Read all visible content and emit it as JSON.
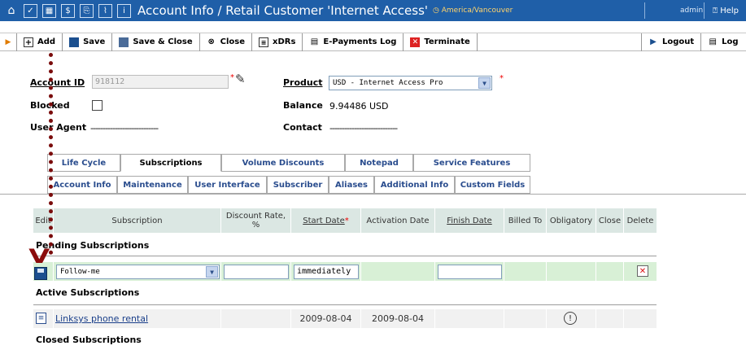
{
  "header": {
    "title": "Account Info / Retail Customer 'Internet Access'",
    "timezone": "America/Vancouver",
    "user": "admin",
    "help": "Help",
    "icons": [
      "home-icon",
      "check-icon",
      "grid-icon",
      "dollar-icon",
      "doc-icon",
      "chart-icon",
      "info-icon"
    ]
  },
  "toolbar": {
    "add": "Add",
    "save": "Save",
    "save_close": "Save & Close",
    "close": "Close",
    "xdrs": "xDRs",
    "epayments": "E-Payments Log",
    "terminate": "Terminate",
    "logout": "Logout",
    "log": "Log"
  },
  "form": {
    "account_id_label": "Account ID",
    "account_id_value": "918112",
    "product_label": "Product",
    "product_value": "USD - Internet Access Pro",
    "blocked_label": "Blocked",
    "balance_label": "Balance",
    "balance_value": "9.94486 USD",
    "user_agent_label": "User Agent",
    "user_agent_value": "----------------------------",
    "contact_label": "Contact",
    "contact_value": "----------------------------",
    "required_mark": "*"
  },
  "tabs": {
    "row1": [
      "Life Cycle",
      "Subscriptions",
      "Volume Discounts",
      "Notepad",
      "Service Features"
    ],
    "row2": [
      "Account Info",
      "Maintenance",
      "User Interface",
      "Subscriber",
      "Aliases",
      "Additional Info",
      "Custom Fields"
    ],
    "active": "Subscriptions"
  },
  "table": {
    "headers": {
      "edit": "Edit",
      "subscription": "Subscription",
      "discount_rate": "Discount Rate, %",
      "start_date": "Start Date",
      "activation_date": "Activation Date",
      "finish_date": "Finish Date",
      "billed_to": "Billed To",
      "obligatory": "Obligatory",
      "close": "Close",
      "delete": "Delete"
    },
    "pending_title": "Pending Subscriptions",
    "pending_row": {
      "subscription": "Follow-me",
      "start_date": "immediately"
    },
    "active_title": "Active Subscriptions",
    "active_row": {
      "subscription": "Linksys phone rental",
      "start_date": "2009-08-04",
      "activation_date": "2009-08-04"
    },
    "closed_title": "Closed Subscriptions"
  }
}
